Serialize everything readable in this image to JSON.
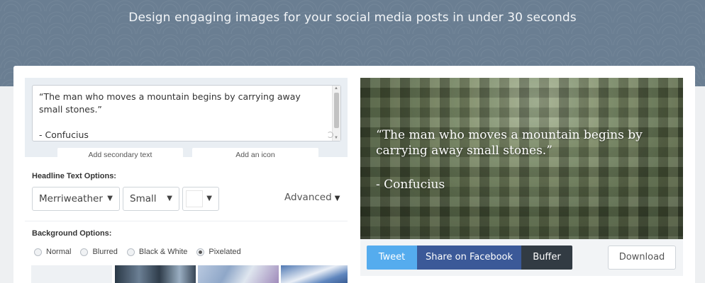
{
  "hero": {
    "tagline": "Design engaging images for your social media posts in under 30 seconds"
  },
  "editor": {
    "quote_text": "“The man who moves a mountain begins by carrying away small stones.”\n\n- Confucius",
    "add_secondary_label": "Add secondary text",
    "add_icon_label": "Add an icon"
  },
  "headline_options": {
    "label": "Headline Text Options:",
    "font": "Merriweather",
    "size": "Small",
    "color": "#ffffff",
    "advanced_label": "Advanced"
  },
  "background_options": {
    "label": "Background Options:",
    "options": [
      "Normal",
      "Blurred",
      "Black & White",
      "Pixelated"
    ],
    "selected": "Pixelated",
    "thumbnails": [
      "blank",
      "city-street",
      "bridge",
      "sky"
    ]
  },
  "preview": {
    "quote": "“The man who moves a mountain begins by carrying away small stones.”",
    "author": "- Confucius"
  },
  "share": {
    "tweet_label": "Tweet",
    "facebook_label": "Share on Facebook",
    "buffer_label": "Buffer",
    "download_label": "Download"
  },
  "colors": {
    "tweet": "#55acee",
    "facebook": "#3b5998",
    "buffer": "#323b43",
    "hero_bg": "#6a7e92"
  }
}
